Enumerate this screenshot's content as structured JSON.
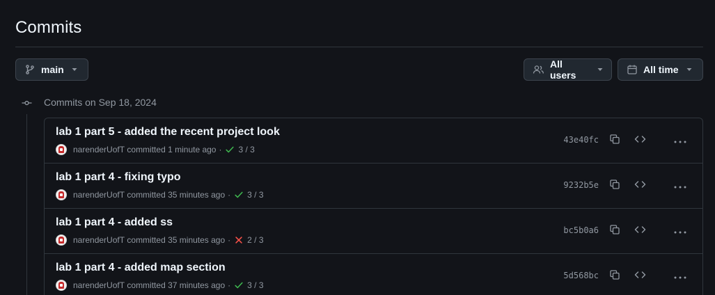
{
  "page": {
    "title": "Commits"
  },
  "filters": {
    "branch": "main",
    "users": "All users",
    "time": "All time"
  },
  "group": {
    "heading": "Commits on Sep 18, 2024"
  },
  "commits": [
    {
      "message": "lab 1 part 5 - added the recent project look",
      "author": "narenderUofT",
      "action": "committed",
      "time": "1 minute ago",
      "status": "success",
      "checks": "3 / 3",
      "sha": "43e40fc"
    },
    {
      "message": "lab 1 part 4 - fixing typo",
      "author": "narenderUofT",
      "action": "committed",
      "time": "35 minutes ago",
      "status": "success",
      "checks": "3 / 3",
      "sha": "9232b5e"
    },
    {
      "message": "lab 1 part 4 - added ss",
      "author": "narenderUofT",
      "action": "committed",
      "time": "35 minutes ago",
      "status": "failure",
      "checks": "2 / 3",
      "sha": "bc5b0a6"
    },
    {
      "message": "lab 1 part 4 - added map section",
      "author": "narenderUofT",
      "action": "committed",
      "time": "37 minutes ago",
      "status": "success",
      "checks": "3 / 3",
      "sha": "5d568bc"
    }
  ],
  "colors": {
    "background": "#121419",
    "border": "#30363d",
    "success": "#3fb950",
    "failure": "#f85149",
    "muted": "#9198a1"
  },
  "icons": {
    "branch": "git-branch-icon",
    "users": "people-icon",
    "time": "calendar-icon",
    "timeline": "git-commit-icon",
    "copy": "copy-icon",
    "browse": "code-icon",
    "more": "kebab-horizontal-icon"
  }
}
